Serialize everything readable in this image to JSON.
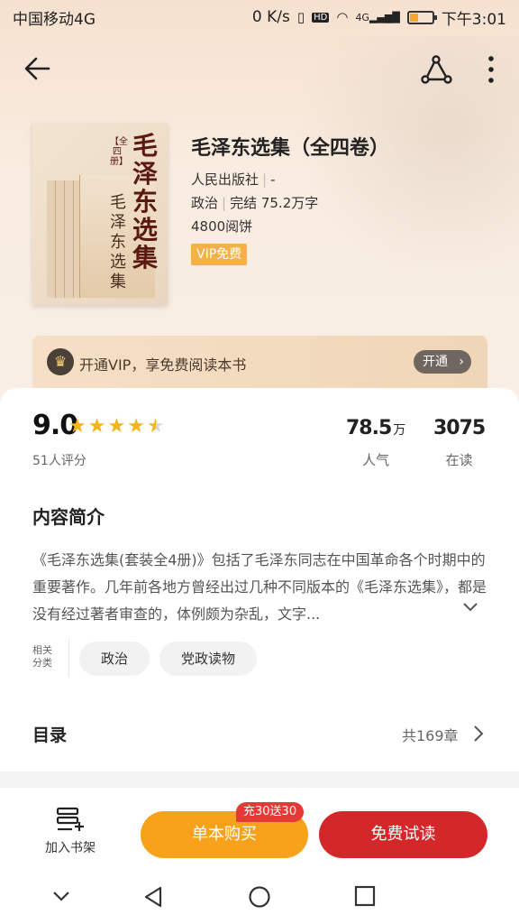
{
  "status_bar": {
    "carrier": "中国移动4G",
    "speed": "0 K/s",
    "time": "下午3:01",
    "hd": "HD",
    "network": "4G"
  },
  "book": {
    "title": "毛泽东选集（全四卷）",
    "publisher": "人民出版社",
    "publisher_extra": "-",
    "category": "政治",
    "status": "完结 75.2万字",
    "reads": "4800阅饼",
    "vip_tag": "VIP免费",
    "cover_title": "毛泽东选集",
    "cover_sub": "【全四册】",
    "cover_front_title": "毛泽东选集"
  },
  "vip_banner": {
    "text": "开通VIP，享免费阅读本书",
    "button": "开通"
  },
  "rating": {
    "score": "9.0",
    "stars": 4.5,
    "count_label": "51人评分"
  },
  "stats": {
    "popularity_value": "78.5",
    "popularity_unit": "万",
    "popularity_label": "人气",
    "reading_value": "3075",
    "reading_label": "在读"
  },
  "intro": {
    "title": "内容简介",
    "text": "《毛泽东选集(套装全4册)》包括了毛泽东同志在中国革命各个时期中的重要著作。几年前各地方曾经出过几种不同版本的《毛泽东选集》，都是没有经过著者审查的，体例颇为杂乱，文字..."
  },
  "categories": {
    "label": "相关分类",
    "items": [
      "政治",
      "党政读物"
    ]
  },
  "toc": {
    "title": "目录",
    "count": "共169章"
  },
  "actions": {
    "shelf_label": "加入书架",
    "buy_label": "单本购买",
    "promo": "充30送30",
    "read_label": "免费试读"
  },
  "colors": {
    "vip_orange": "#f5b04a",
    "buy_orange": "#f7a21a",
    "read_red": "#d4272a",
    "promo_red": "#e53935",
    "star_gold": "#f5b41a"
  },
  "icons": {
    "back": "arrow-left-icon",
    "share": "share-icon",
    "more": "more-vertical-icon",
    "crown": "crown-icon",
    "expand": "chevron-down-icon",
    "toc": "chevron-right-icon",
    "shelf": "bookshelf-add-icon"
  }
}
